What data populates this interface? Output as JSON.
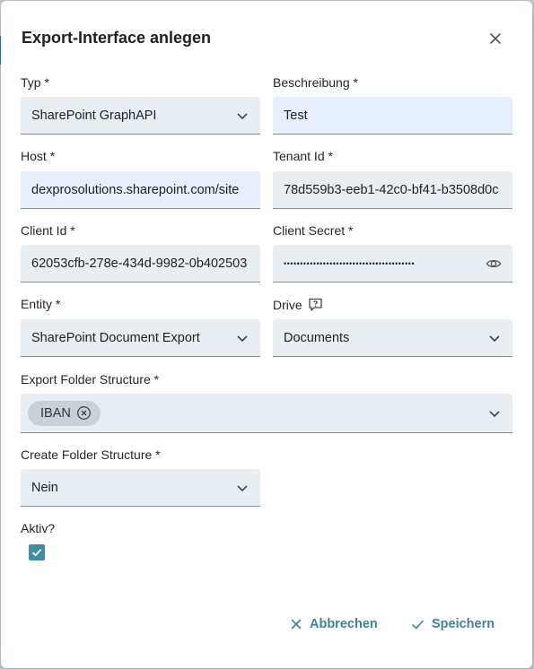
{
  "dialog": {
    "title": "Export-Interface anlegen"
  },
  "fields": {
    "typ": {
      "label": "Typ *",
      "value": "SharePoint GraphAPI"
    },
    "beschreibung": {
      "label": "Beschreibung *",
      "value": "Test"
    },
    "host": {
      "label": "Host *",
      "value": "dexprosolutions.sharepoint.com/site"
    },
    "tenant_id": {
      "label": "Tenant Id *",
      "value": "78d559b3-eeb1-42c0-bf41-b3508d0c"
    },
    "client_id": {
      "label": "Client Id *",
      "value": "62053cfb-278e-434d-9982-0b402503"
    },
    "client_secret": {
      "label": "Client Secret *",
      "value": "••••••••••••••••••••••••••••••••••••••••"
    },
    "entity": {
      "label": "Entity *",
      "value": "SharePoint Document Export"
    },
    "drive": {
      "label": "Drive",
      "value": "Documents"
    },
    "export_folder_structure": {
      "label": "Export Folder Structure *",
      "chips": [
        "IBAN"
      ]
    },
    "create_folder_structure": {
      "label": "Create Folder Structure *",
      "value": "Nein"
    },
    "aktiv": {
      "label": "Aktiv?",
      "checked": true
    }
  },
  "actions": {
    "cancel_label": "Abbrechen",
    "save_label": "Speichern"
  },
  "icons": {
    "close": "close-icon",
    "chevron": "chevron-down-icon",
    "eye": "eye-icon",
    "help": "help-icon",
    "chip_remove": "remove-chip-icon",
    "check": "check-icon"
  },
  "colors": {
    "accent": "#3b8597",
    "field_bg": "#e9eef2",
    "field_focus_bg": "#e7effd",
    "checkbox": "#3f8ea3"
  }
}
